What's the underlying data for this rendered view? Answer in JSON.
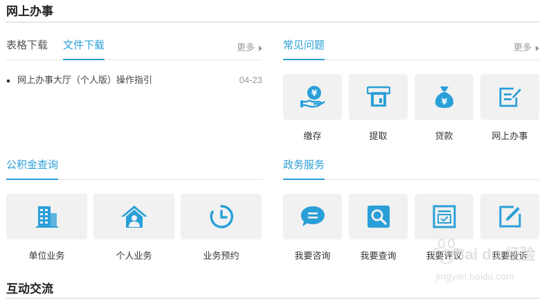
{
  "header": {
    "title": "网上办事"
  },
  "downloads": {
    "tabs": [
      {
        "label": "表格下载"
      },
      {
        "label": "文件下载"
      }
    ],
    "more": "更多",
    "items": [
      {
        "title": "网上办事大厅（个人版）操作指引",
        "date": "04-23"
      }
    ]
  },
  "faq": {
    "title": "常见问题",
    "more": "更多",
    "tiles": [
      {
        "label": "缴存",
        "icon": "hand-coin-icon"
      },
      {
        "label": "提取",
        "icon": "atm-card-icon"
      },
      {
        "label": "贷款",
        "icon": "money-bag-icon"
      },
      {
        "label": "网上办事",
        "icon": "edit-doc-icon"
      }
    ]
  },
  "fund_query": {
    "title": "公积金查询",
    "tiles": [
      {
        "label": "单位业务",
        "icon": "building-icon"
      },
      {
        "label": "个人业务",
        "icon": "house-person-icon"
      },
      {
        "label": "业务预约",
        "icon": "clock-icon"
      }
    ]
  },
  "gov_service": {
    "title": "政务服务",
    "tiles": [
      {
        "label": "我要咨询",
        "icon": "chat-bubble-icon"
      },
      {
        "label": "我要查询",
        "icon": "search-icon"
      },
      {
        "label": "我要评议",
        "icon": "check-board-icon"
      },
      {
        "label": "我要投诉",
        "icon": "edit-square-icon"
      }
    ]
  },
  "interaction": {
    "title": "互动交流"
  },
  "watermark": {
    "brand": "Bai du 经验",
    "url": "jingyan.baidu.com"
  },
  "colors": {
    "accent": "#2a9fd8",
    "tile_bg": "#f1f1f1",
    "text": "#333333",
    "muted": "#999999"
  }
}
